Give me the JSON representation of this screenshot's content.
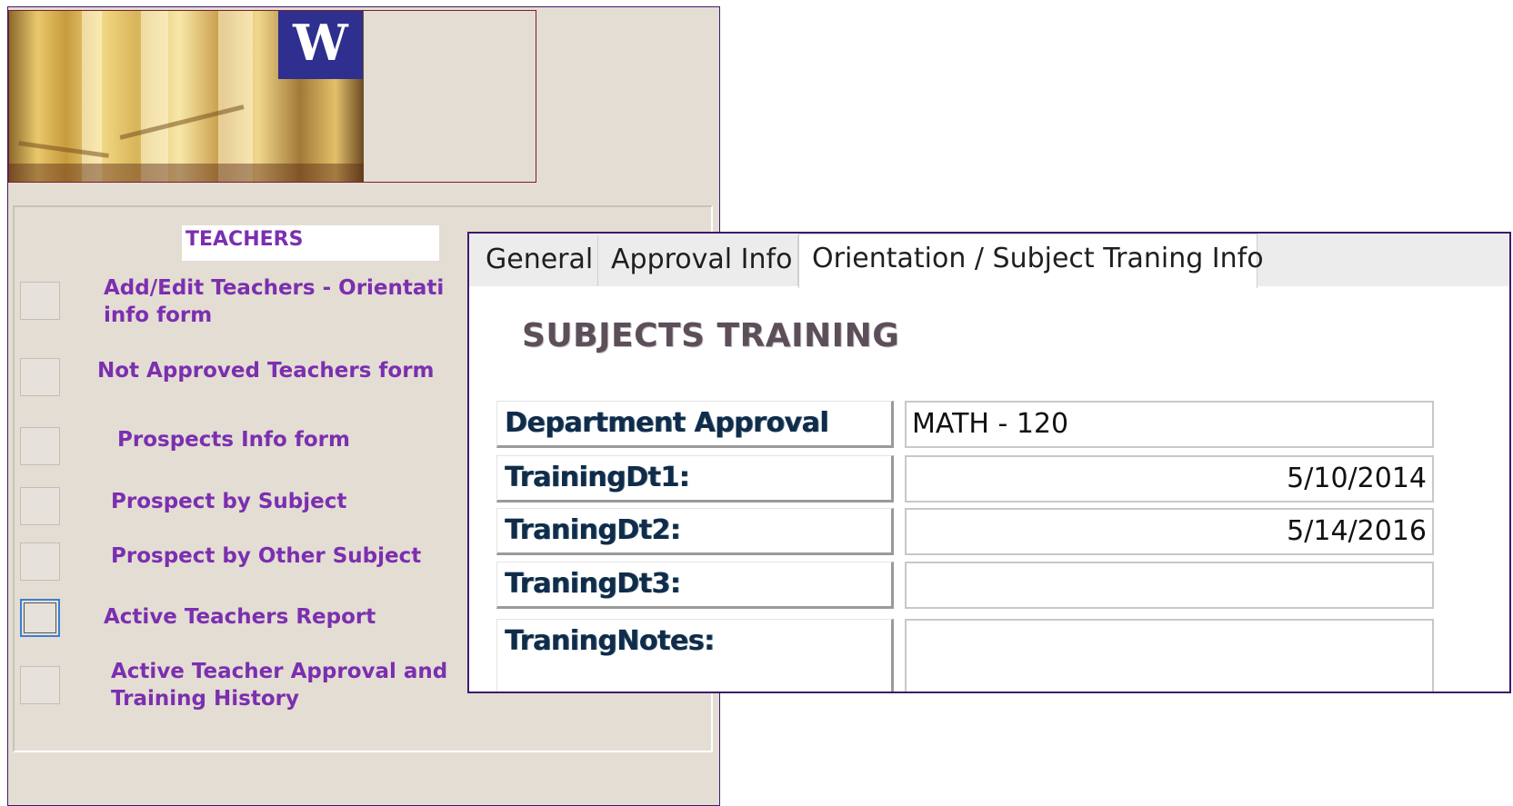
{
  "switchboard": {
    "banner_logo_letter": "W",
    "menu_title": "TEACHERS",
    "items": [
      {
        "line1": "Add/Edit Teachers - Orientati",
        "line2": "info form"
      },
      {
        "line1": "Not Approved Teachers form"
      },
      {
        "line1": "Prospects Info form"
      },
      {
        "line1": "Prospect by Subject"
      },
      {
        "line1": "Prospect by Other Subject"
      },
      {
        "line1": "Active Teachers Report",
        "focused": true
      },
      {
        "line1": "Active Teacher Approval and",
        "line2": "Training History"
      }
    ]
  },
  "form": {
    "tabs": [
      {
        "label": "General"
      },
      {
        "label": "Approval Info"
      },
      {
        "label": "Orientation / Subject Traning Info",
        "active": true
      }
    ],
    "section_title": "SUBJECTS TRAINING",
    "fields": [
      {
        "label": "Department Approval",
        "value": "MATH - 120"
      },
      {
        "label": "TrainingDt1:",
        "value": "5/10/2014"
      },
      {
        "label": "TraningDt2:",
        "value": "5/14/2016"
      },
      {
        "label": "TraningDt3:",
        "value": ""
      },
      {
        "label": "TraningNotes:",
        "value": ""
      }
    ]
  },
  "colors": {
    "menu_text": "#7b2fb0",
    "window_border": "#3d1a6e",
    "logo_bg": "#2e2f8f",
    "switchboard_bg": "#e4ddd3"
  }
}
